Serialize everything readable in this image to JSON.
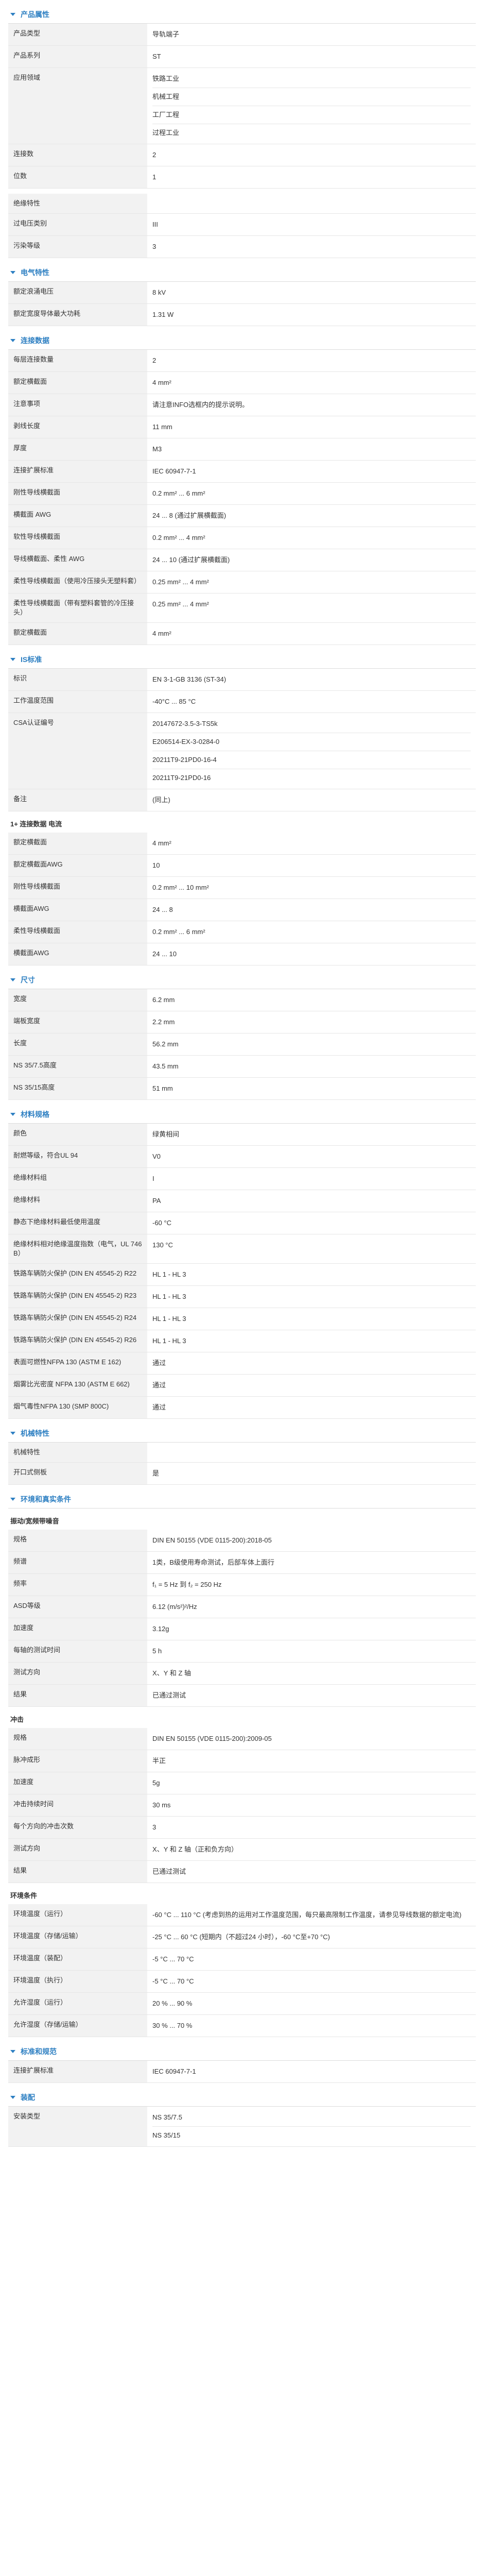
{
  "sections": [
    {
      "title": "产品属性",
      "groups": [
        {
          "subtitle": "",
          "rows": [
            {
              "label": "产品类型",
              "values": [
                "导轨端子"
              ]
            },
            {
              "label": "产品系列",
              "values": [
                "ST"
              ]
            },
            {
              "label": "应用领域",
              "values": [
                "铁路工业",
                "机械工程",
                "工厂工程",
                "过程工业"
              ]
            },
            {
              "label": "连接数",
              "values": [
                "2"
              ]
            },
            {
              "label": "位数",
              "values": [
                "1"
              ]
            }
          ]
        }
      ]
    },
    {
      "title": "",
      "groups": [
        {
          "subtitle": "",
          "rows": [
            {
              "label": "绝缘特性",
              "values": [
                ""
              ]
            },
            {
              "label": "过电压类别",
              "values": [
                "III"
              ]
            },
            {
              "label": "污染等级",
              "values": [
                "3"
              ]
            }
          ]
        }
      ]
    },
    {
      "title": "电气特性",
      "groups": [
        {
          "subtitle": "",
          "rows": [
            {
              "label": "额定浪涌电压",
              "values": [
                "8 kV"
              ]
            },
            {
              "label": "额定宽度导体最大功耗",
              "values": [
                "1.31 W"
              ]
            }
          ]
        }
      ]
    },
    {
      "title": "连接数据",
      "groups": [
        {
          "subtitle": "",
          "rows": [
            {
              "label": "每层连接数量",
              "values": [
                "2"
              ]
            },
            {
              "label": "额定横截面",
              "values": [
                "4 mm²"
              ]
            },
            {
              "label": "注意事项",
              "values": [
                "请注意INFO选框内的提示说明。"
              ]
            },
            {
              "label": "剥线长度",
              "values": [
                "11 mm"
              ]
            },
            {
              "label": "厚度",
              "values": [
                "M3"
              ]
            },
            {
              "label": "连接扩展标准",
              "values": [
                "IEC 60947-7-1"
              ]
            },
            {
              "label": "刚性导线横截面",
              "values": [
                "0.2 mm² ... 6 mm²"
              ]
            },
            {
              "label": "横截面 AWG",
              "values": [
                "24 ... 8 (通过扩展横截面)"
              ]
            },
            {
              "label": "软性导线横截面",
              "values": [
                "0.2 mm² ... 4 mm²"
              ]
            },
            {
              "label": "导线横截面、柔性 AWG",
              "values": [
                "24 ... 10 (通过扩展横截面)"
              ]
            },
            {
              "label": "柔性导线横截面（使用冷压接头无塑料套）",
              "values": [
                "0.25 mm² ... 4 mm²"
              ]
            },
            {
              "label": "柔性导线横截面（带有塑料套管的冷压接头）",
              "values": [
                "0.25 mm² ... 4 mm²"
              ]
            },
            {
              "label": "额定横截面",
              "values": [
                "4 mm²"
              ]
            }
          ]
        }
      ]
    },
    {
      "title": "IS标准",
      "groups": [
        {
          "subtitle": "",
          "rows": [
            {
              "label": "标识",
              "values": [
                "EN 3-1-GB 3136 (ST-34)"
              ]
            },
            {
              "label": "工作温度范围",
              "values": [
                "-40°C ... 85 °C"
              ]
            },
            {
              "label": "CSA认证编号",
              "values": [
                "20147672-3.5-3-TS5k",
                "E206514-EX-3-0284-0",
                "20211T9-21PD0-16-4",
                "20211T9-21PD0-16"
              ]
            },
            {
              "label": "备注",
              "values": [
                "(同上)"
              ]
            }
          ]
        },
        {
          "subtitle": "1+ 连接数据 电流",
          "rows": [
            {
              "label": "额定横截面",
              "values": [
                "4 mm²"
              ]
            },
            {
              "label": "额定横截面AWG",
              "values": [
                "10"
              ]
            },
            {
              "label": "刚性导线横截面",
              "values": [
                "0.2 mm² ... 10 mm²"
              ]
            },
            {
              "label": "横截面AWG",
              "values": [
                "24 ... 8"
              ]
            },
            {
              "label": "柔性导线横截面",
              "values": [
                "0.2 mm² ... 6 mm²"
              ]
            },
            {
              "label": "横截面AWG",
              "values": [
                "24 ... 10"
              ]
            }
          ]
        }
      ]
    },
    {
      "title": "尺寸",
      "groups": [
        {
          "subtitle": "",
          "rows": [
            {
              "label": "宽度",
              "values": [
                "6.2 mm"
              ]
            },
            {
              "label": "端板宽度",
              "values": [
                "2.2 mm"
              ]
            },
            {
              "label": "长度",
              "values": [
                "56.2 mm"
              ]
            },
            {
              "label": "NS 35/7.5高度",
              "values": [
                "43.5 mm"
              ]
            },
            {
              "label": "NS 35/15高度",
              "values": [
                "51 mm"
              ]
            }
          ]
        }
      ]
    },
    {
      "title": "材料规格",
      "groups": [
        {
          "subtitle": "",
          "rows": [
            {
              "label": "颜色",
              "values": [
                "绿黄相间"
              ]
            },
            {
              "label": "耐燃等级，符合UL 94",
              "values": [
                "V0"
              ]
            },
            {
              "label": "绝缘材料组",
              "values": [
                "I"
              ]
            },
            {
              "label": "绝缘材料",
              "values": [
                "PA"
              ]
            },
            {
              "label": "静态下绝缘材料最低使用温度",
              "values": [
                "-60 °C"
              ]
            },
            {
              "label": "绝缘材料相对绝缘温度指数（电气，UL 746 B）",
              "values": [
                "130 °C"
              ]
            },
            {
              "label": "铁路车辆防火保护 (DIN EN 45545-2) R22",
              "values": [
                "HL 1 - HL 3"
              ]
            },
            {
              "label": "铁路车辆防火保护 (DIN EN 45545-2) R23",
              "values": [
                "HL 1 - HL 3"
              ]
            },
            {
              "label": "铁路车辆防火保护 (DIN EN 45545-2) R24",
              "values": [
                "HL 1 - HL 3"
              ]
            },
            {
              "label": "铁路车辆防火保护 (DIN EN 45545-2) R26",
              "values": [
                "HL 1 - HL 3"
              ]
            },
            {
              "label": "表面可燃性NFPA 130 (ASTM E 162)",
              "values": [
                "通过"
              ]
            },
            {
              "label": "烟雾比光密度 NFPA 130 (ASTM E 662)",
              "values": [
                "通过"
              ]
            },
            {
              "label": "烟气毒性NFPA 130 (SMP 800C)",
              "values": [
                "通过"
              ]
            }
          ]
        }
      ]
    },
    {
      "title": "机械特性",
      "groups": [
        {
          "subtitle": "",
          "rows": [
            {
              "label": "机械特性",
              "values": [
                ""
              ]
            },
            {
              "label": "开口式侧板",
              "values": [
                "是"
              ]
            }
          ]
        }
      ]
    },
    {
      "title": "环境和真实条件",
      "groups": [
        {
          "subtitle": "振动/宽频带噪音",
          "rows": [
            {
              "label": "规格",
              "values": [
                "DIN EN 50155 (VDE 0115-200):2018-05"
              ]
            },
            {
              "label": "频谱",
              "values": [
                "1类，B级使用寿命测试，后部车体上面行"
              ]
            },
            {
              "label": "频率",
              "values": [
                "f₁ = 5 Hz 到 f₂ = 250 Hz"
              ]
            },
            {
              "label": "ASD等级",
              "values": [
                "6.12 (m/s²)²/Hz"
              ]
            },
            {
              "label": "加速度",
              "values": [
                "3.12g"
              ]
            },
            {
              "label": "每轴的测试时间",
              "values": [
                "5 h"
              ]
            },
            {
              "label": "测试方向",
              "values": [
                "X、Y 和 Z 轴"
              ]
            },
            {
              "label": "结果",
              "values": [
                "已通过测试"
              ]
            }
          ]
        },
        {
          "subtitle": "冲击",
          "rows": [
            {
              "label": "规格",
              "values": [
                "DIN EN 50155 (VDE 0115-200):2009-05"
              ]
            },
            {
              "label": "脉冲成形",
              "values": [
                "半正"
              ]
            },
            {
              "label": "加速度",
              "values": [
                "5g"
              ]
            },
            {
              "label": "冲击持续时间",
              "values": [
                "30 ms"
              ]
            },
            {
              "label": "每个方向的冲击次数",
              "values": [
                "3"
              ]
            },
            {
              "label": "测试方向",
              "values": [
                "X、Y 和 Z 轴（正和负方向）"
              ]
            },
            {
              "label": "结果",
              "values": [
                "已通过测试"
              ]
            }
          ]
        },
        {
          "subtitle": "环境条件",
          "rows": [
            {
              "label": "环境温度（运行）",
              "values": [
                "-60 °C ... 110 °C (考虑到热的运用对工作温度范围，每只最高限制工作温度，请参见导线数据的额定电流)"
              ]
            },
            {
              "label": "环境温度（存储/运输）",
              "values": [
                "-25 °C ... 60 °C (短期内（不超过24 小时），-60 °C至+70 °C)"
              ]
            },
            {
              "label": "环境温度（装配）",
              "values": [
                "-5 °C ... 70 °C"
              ]
            },
            {
              "label": "环境温度（执行）",
              "values": [
                "-5 °C ... 70 °C"
              ]
            },
            {
              "label": "允许湿度（运行）",
              "values": [
                "20 % ... 90 %"
              ]
            },
            {
              "label": "允许湿度（存储/运输）",
              "values": [
                "30 % ... 70 %"
              ]
            }
          ]
        }
      ]
    },
    {
      "title": "标准和规范",
      "groups": [
        {
          "subtitle": "",
          "rows": [
            {
              "label": "连接扩展标准",
              "values": [
                "IEC 60947-7-1"
              ]
            }
          ]
        }
      ]
    },
    {
      "title": "装配",
      "groups": [
        {
          "subtitle": "",
          "rows": [
            {
              "label": "安装类型",
              "values": [
                "NS 35/7.5",
                "NS 35/15"
              ]
            }
          ]
        }
      ]
    }
  ]
}
